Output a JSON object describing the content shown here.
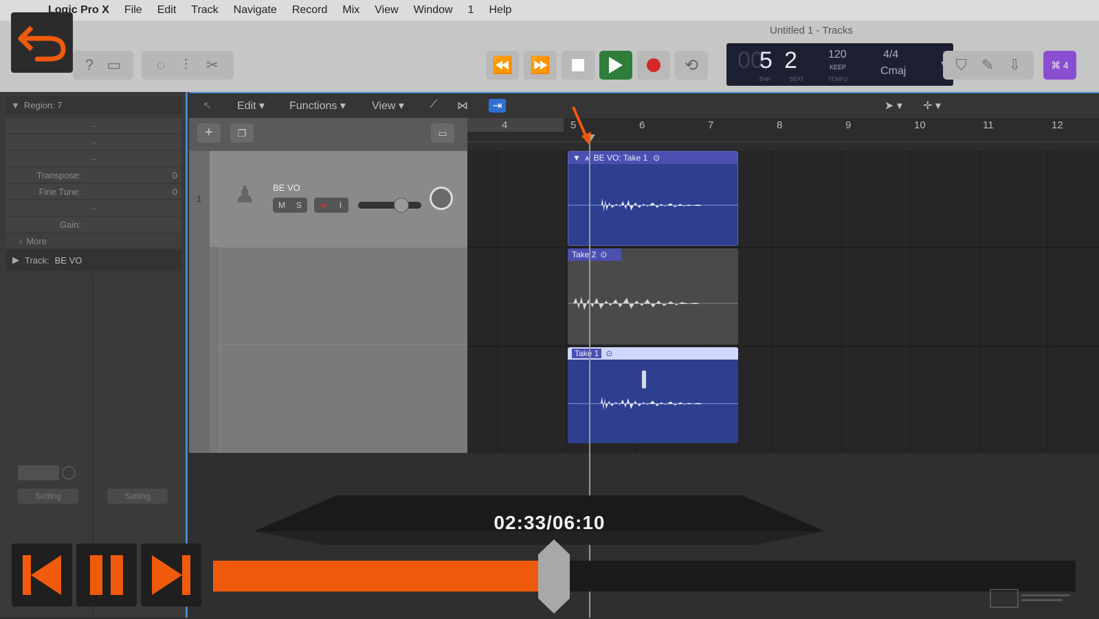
{
  "menubar": {
    "items": [
      "Logic Pro X",
      "File",
      "Edit",
      "Track",
      "Navigate",
      "Record",
      "Mix",
      "View",
      "Window",
      "1",
      "Help"
    ]
  },
  "window_title": "Untitled 1 - Tracks",
  "lcd": {
    "bar": "5",
    "beat": "2",
    "tempo": "120",
    "tempo_label": "KEEP",
    "signature": "4/4",
    "key": "Cmaj",
    "bar_label": "BAR",
    "beat_label": "BEAT",
    "tempo_sub": "TEMPO"
  },
  "avatar_badge": "⌘ 4",
  "inspector": {
    "region_header": "Region: 7",
    "transpose_label": "Transpose:",
    "transpose_value": "0",
    "finetune_label": "Fine Tune:",
    "finetune_value": "0",
    "gain_label": "Gain:",
    "more_label": "More",
    "track_header": "Track:",
    "track_name": "BE VO",
    "setting_label": "Setting"
  },
  "tracks_toolbar": {
    "edit": "Edit",
    "functions": "Functions",
    "view": "View"
  },
  "ruler": [
    "4",
    "5",
    "6",
    "7",
    "8",
    "9",
    "10",
    "11",
    "12"
  ],
  "track": {
    "number": "1",
    "name": "BE VO",
    "mute": "M",
    "solo": "S",
    "input": "I"
  },
  "regions": {
    "main_label": "BE VO: Take 1",
    "take2_label": "Take 2",
    "take1_label": "Take 1"
  },
  "player": {
    "time": "02:33/06:10",
    "progress": 0.395
  },
  "colors": {
    "accent": "#f05a0c",
    "region_blue": "#2e3f8f",
    "take_gray": "#4a4a4a"
  }
}
